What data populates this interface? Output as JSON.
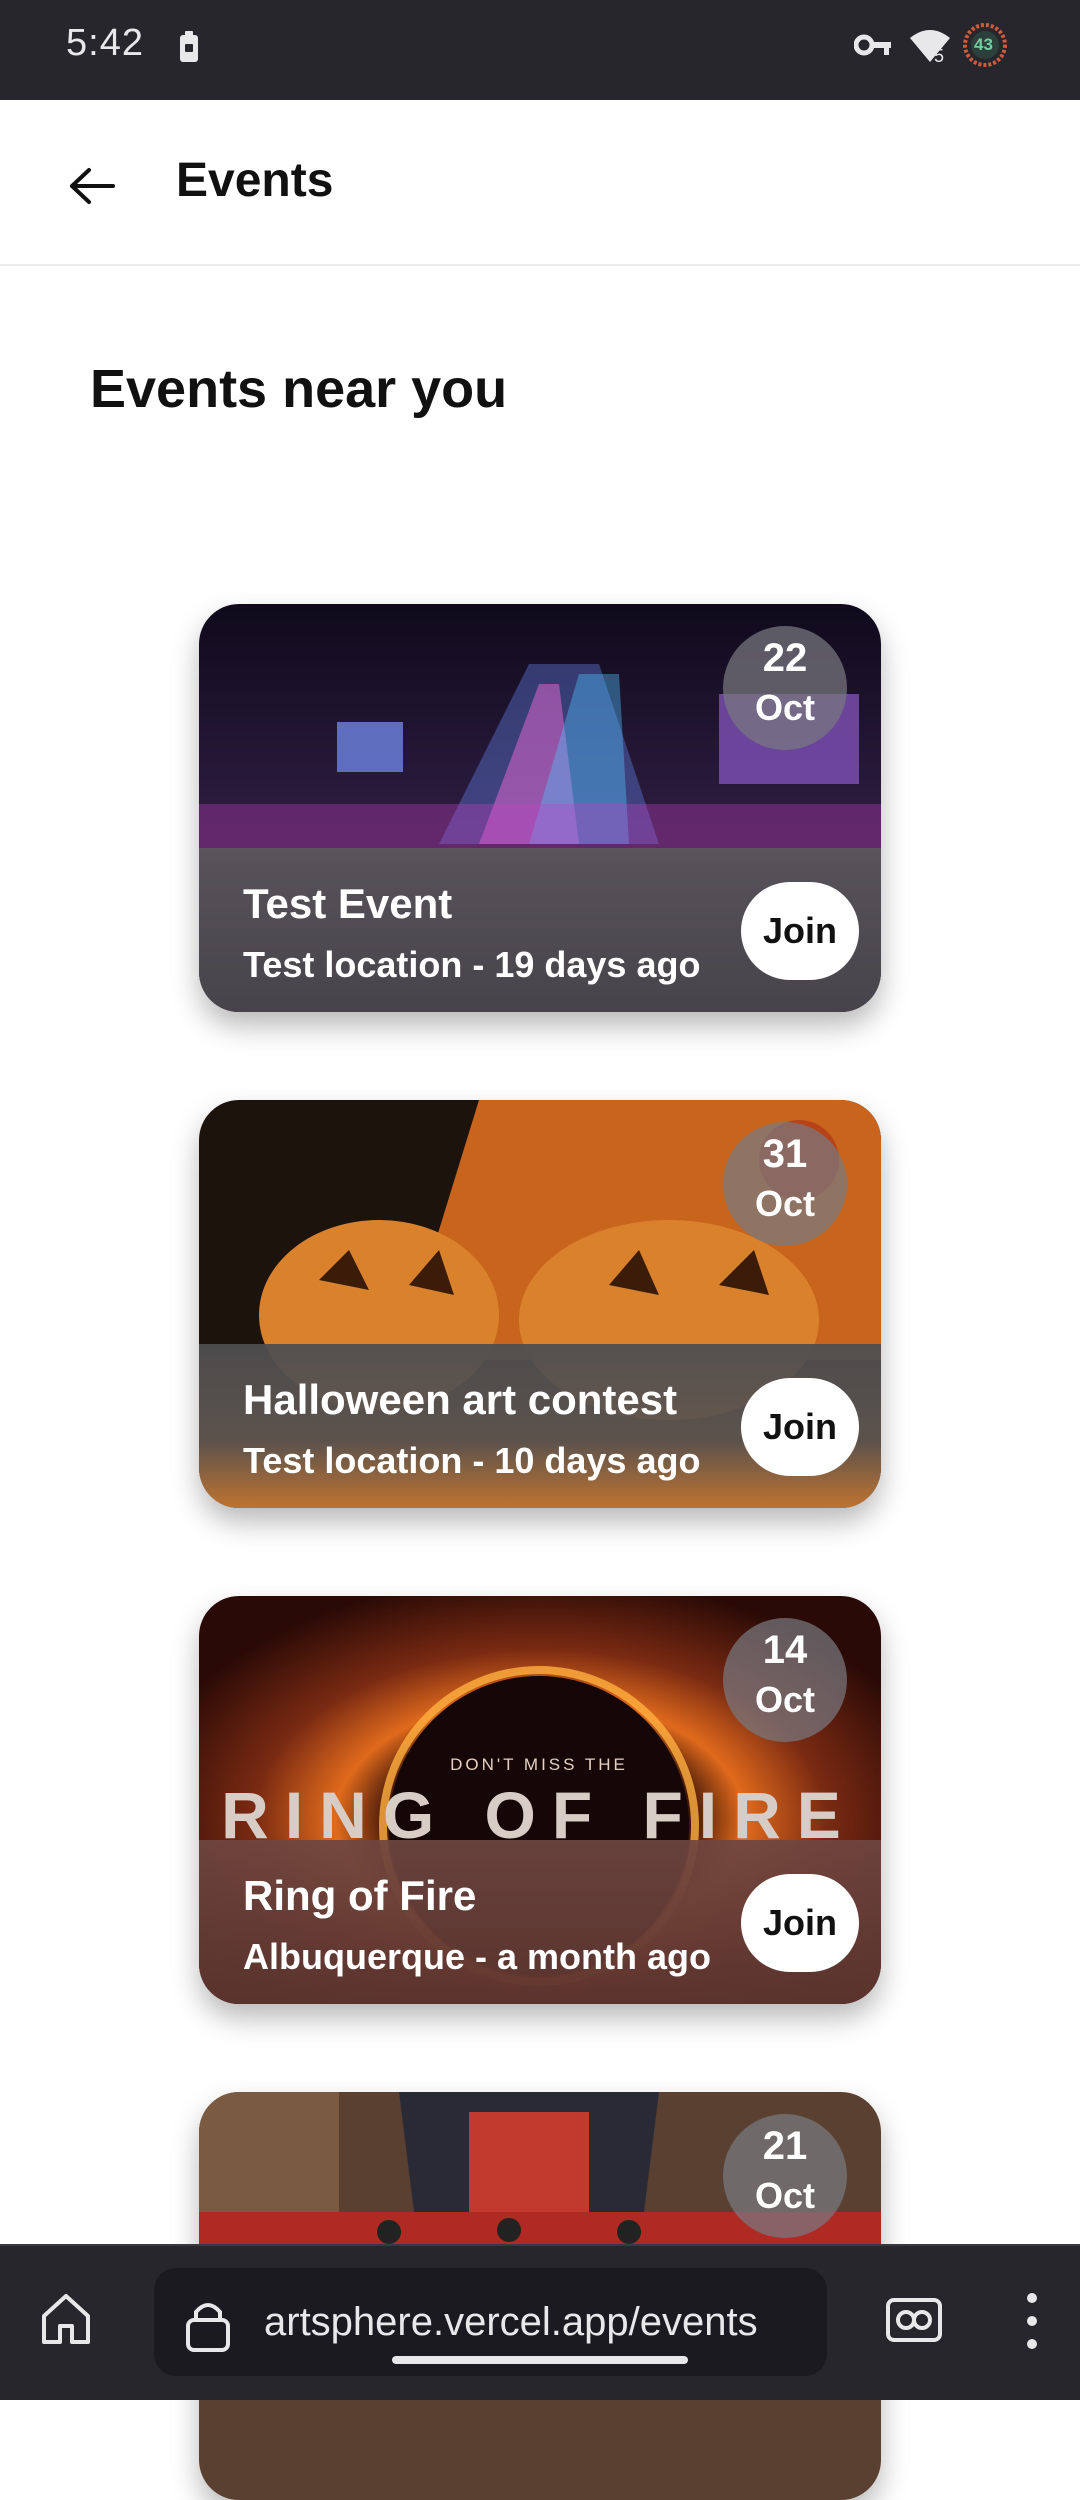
{
  "status_bar": {
    "time": "5:42",
    "wifi_badge": "5",
    "battery_level": "43",
    "icons": [
      "battery-saver-icon",
      "vpn-key-icon",
      "wifi-icon",
      "battery-ring-icon"
    ]
  },
  "app_bar": {
    "title": "Events",
    "back_icon": "arrow-left-icon"
  },
  "section_title": "Events near you",
  "events": [
    {
      "title": "Test Event",
      "subtitle": "Test location - 19 days ago",
      "day": "22",
      "month": "Oct",
      "join_label": "Join",
      "image_description_colors": [
        "#2b1b3d",
        "#c43fc4",
        "#4f8fff"
      ]
    },
    {
      "title": "Halloween art contest",
      "subtitle": "Test location - 10 days ago",
      "day": "31",
      "month": "Oct",
      "join_label": "Join",
      "image_description_colors": [
        "#1c140c",
        "#d9822b",
        "#b45f1e"
      ]
    },
    {
      "title": "Ring of Fire",
      "subtitle": "Albuquerque - a month ago",
      "day": "14",
      "month": "Oct",
      "join_label": "Join",
      "poster_small_text": "DON'T MISS THE",
      "poster_big_text": "RING OF FIRE",
      "image_description_colors": [
        "#3a120a",
        "#e06a1c",
        "#7a2a12"
      ]
    },
    {
      "title": "",
      "subtitle": "",
      "day": "21",
      "month": "Oct",
      "join_label": "",
      "image_description_colors": [
        "#3a2a20",
        "#c23a2e",
        "#7a5a40"
      ]
    }
  ],
  "browser": {
    "url": "artsphere.vercel.app/events",
    "icons": [
      "home-icon",
      "lock-icon",
      "reader-mode-icon",
      "more-vert-icon"
    ]
  }
}
